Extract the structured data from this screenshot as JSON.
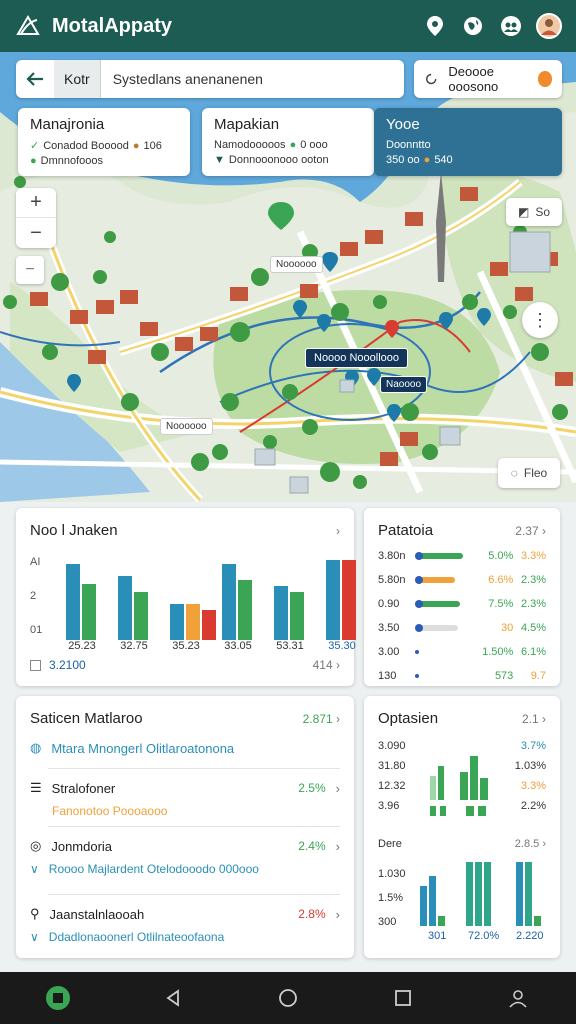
{
  "app": {
    "title": "MotalAppaty"
  },
  "colors": {
    "primary": "#1c5c52",
    "accent_blue": "#2a8fb8",
    "accent_green": "#3aa655",
    "accent_orange": "#f0a13a",
    "accent_red": "#d93b30",
    "nav_bg": "#1a1a1a"
  },
  "header_icons": [
    "location-pin-icon",
    "globe-icon",
    "people-icon",
    "avatar"
  ],
  "search": {
    "chip": "Kotr",
    "query": "Systedlans anenanenen"
  },
  "weather": {
    "label": "Deoooe ooosono"
  },
  "map_cards": [
    {
      "title": "Manajronia",
      "line1": "Conadod Booood",
      "line1_value": "106",
      "line2": "Dmnnofooos"
    },
    {
      "title": "Mapakian",
      "line1": "Namodooooos",
      "line1_value": "0 ooo",
      "line2": "Donnooonooo ooton"
    },
    {
      "title": "Yooe",
      "line1": "Doonntto",
      "line2": "350 oo",
      "line2_value": "540"
    }
  ],
  "map_controls": {
    "zoom_in": "+",
    "zoom_out": "−",
    "minus": "−",
    "layers_label": "So",
    "more": "⋮",
    "filter_label": "Fleo"
  },
  "map_labels": {
    "center": "Noooo  Nooollooo",
    "small1": "Noooooo",
    "small2": "Naoooo",
    "small3": "Noooooo"
  },
  "sales_panel": {
    "title": "Noo l Jnaken",
    "y_labels": [
      "AI",
      "2",
      "01"
    ],
    "groups": [
      {
        "label": "25.23",
        "bars": [
          0.95,
          0.7
        ]
      },
      {
        "label": "32.75",
        "bars": [
          0.8,
          0.6
        ]
      },
      {
        "label": "35.23",
        "bars": [
          0.45,
          0.45,
          0.38
        ]
      },
      {
        "label": "33.05",
        "bars": [
          0.95,
          0.75
        ]
      },
      {
        "label": "53.31",
        "bars": [
          0.68,
          0.6
        ]
      },
      {
        "label": "35.30",
        "bars": [
          1.0,
          1.0
        ]
      }
    ],
    "footer_left": "3.2100",
    "footer_right": "414"
  },
  "patatoia_panel": {
    "title": "Patatoia",
    "header_value": "2.37",
    "rows": [
      {
        "a": "3.80n",
        "fill": 0.9,
        "color": "#3aa655",
        "v1": "5.0%",
        "v2": "3.3%",
        "c1": "#3aa655",
        "c2": "#f0a13a"
      },
      {
        "a": "5.80n",
        "fill": 0.75,
        "color": "#f0a13a",
        "v1": "6.6%",
        "v2": "2.3%",
        "c1": "#f0a13a",
        "c2": "#3aa655"
      },
      {
        "a": "0.90",
        "fill": 0.85,
        "color": "#3aa655",
        "v1": "7.5%",
        "v2": "2.3%",
        "c1": "#3aa655",
        "c2": "#3aa655"
      },
      {
        "a": "3.50",
        "fill": 0.8,
        "color": "#dddddd",
        "v1": "30",
        "v2": "4.5%",
        "c1": "#f0a13a",
        "c2": "#3aa655"
      },
      {
        "a": "3.00",
        "fill": 0.0,
        "color": "#dddddd",
        "v1": "1.50%",
        "v2": "6.1%",
        "c1": "#3aa655",
        "c2": "#3aa655"
      },
      {
        "a": "130",
        "fill": 0.0,
        "color": "#dddddd",
        "v1": "573",
        "v2": "9.7",
        "c1": "#3aa655",
        "c2": "#f0a13a"
      }
    ]
  },
  "station_panel": {
    "title": "Saticen Matlaroo",
    "header_value": "2.871",
    "items": [
      {
        "icon": "info-icon",
        "text": "Mtara  Mnongerl  Olitlaroatonona",
        "value": "",
        "color": "#2a8fb8"
      },
      {
        "icon": "menu-icon",
        "text": "Stralofoner",
        "sub": "Fanonotoo  Poooaooo",
        "value": "2.5%",
        "color": "#f0a13a",
        "vcolor": "#3aa655"
      },
      {
        "icon": "pin-icon",
        "text": "Jonmdoria",
        "sub": "Roooo Majlardent  Otelodooodo 000ooo",
        "value": "2.4%",
        "color": "#2a8fb8",
        "vcolor": "#3aa655"
      },
      {
        "icon": "pin-icon",
        "text": "Jaanstalnlaooah",
        "sub": "Ddadlonaoonerl  Otlilnateoofaona",
        "value": "2.8%",
        "color": "#2a8fb8",
        "vcolor": "#d93b30"
      }
    ]
  },
  "options_panel": {
    "title": "Optasien",
    "header_value": "2.1",
    "rows_top": [
      {
        "label": "3.090",
        "value": "3.7%",
        "color": "#2a8fb8"
      },
      {
        "label": "31.80",
        "value": "1.03%",
        "color": "#333333"
      },
      {
        "label": "12.32",
        "value": "3.3%",
        "color": "#f0a13a"
      },
      {
        "label": "3.96",
        "value": "2.2%",
        "color": "#333333"
      }
    ],
    "sub_title": "Dere",
    "sub_value": "2.8.5",
    "rows_bottom": [
      "1.030",
      "1.5%",
      "300"
    ],
    "bottom_labels": [
      "301",
      "72.0%",
      "2.220"
    ]
  },
  "navbar": {
    "icons": [
      "home-icon",
      "back-icon",
      "home-circle-icon",
      "recent-apps-icon",
      "profile-icon"
    ]
  }
}
